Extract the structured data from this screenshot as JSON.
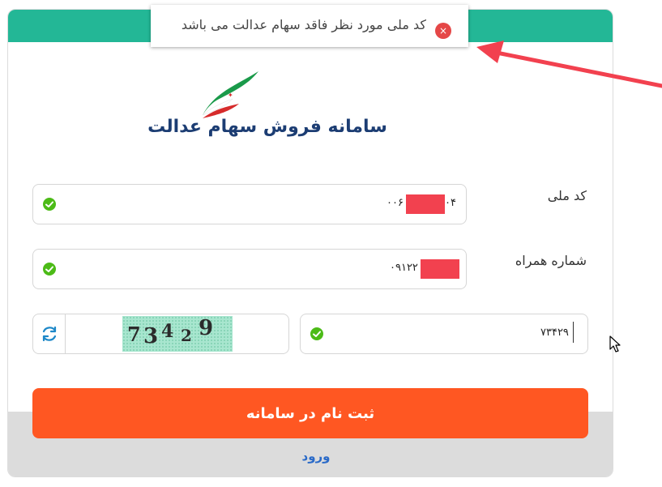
{
  "app": {
    "title": "سامانه فروش سهام عدالت"
  },
  "toast": {
    "message": "کد ملی مورد نظر فاقد سهام عدالت می باشد",
    "close_glyph": "×",
    "icon": "close-icon"
  },
  "form": {
    "national_code": {
      "label": "کد ملی",
      "value_start": "۰۰۶",
      "value_end": "۰۴",
      "status_icon": "check-circle-icon"
    },
    "mobile": {
      "label": "شماره همراه",
      "value_start": "۰۹۱۲۲",
      "status_icon": "check-circle-icon"
    },
    "captcha": {
      "value": "۷۳۴۲۹",
      "image_chars": [
        "7",
        "3",
        "4",
        "2",
        "9"
      ],
      "refresh_icon": "refresh-icon",
      "status_icon": "check-circle-icon"
    }
  },
  "actions": {
    "submit_label": "ثبت نام در سامانه",
    "login_label": "ورود"
  },
  "colors": {
    "header": "#23b796",
    "submit": "#ff5722",
    "title": "#1c3d73",
    "success": "#4cbb17",
    "error": "#e54747",
    "annotation_arrow": "#f2414f"
  }
}
